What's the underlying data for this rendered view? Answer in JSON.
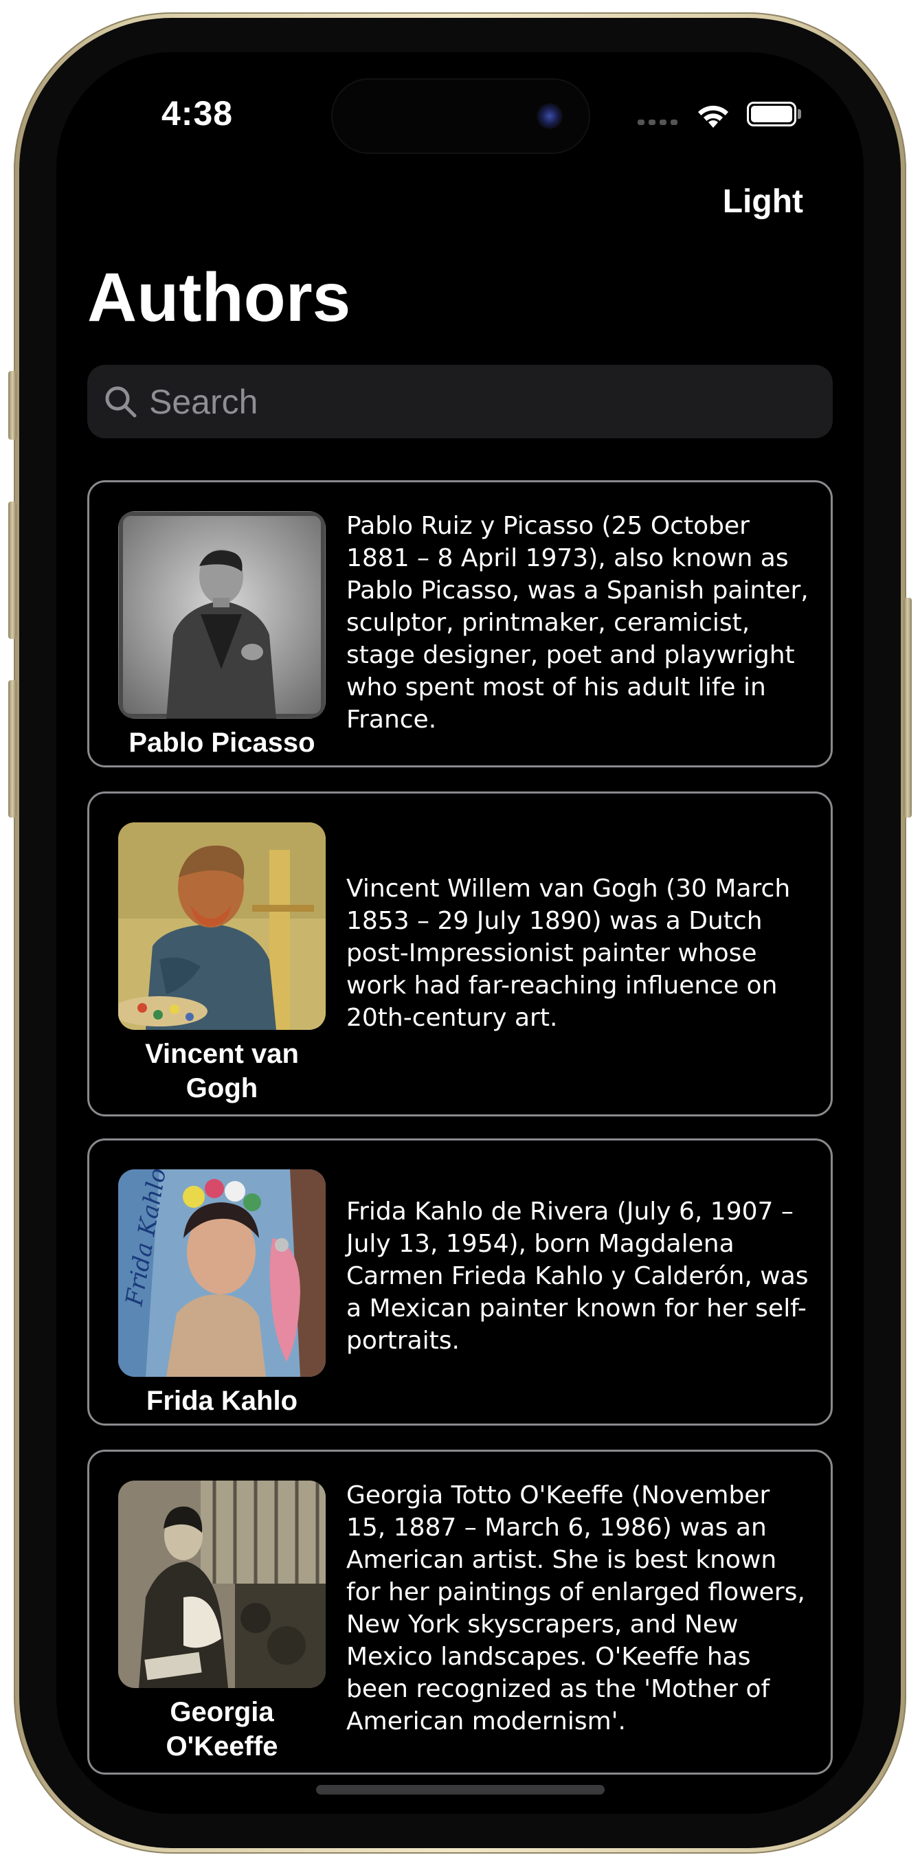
{
  "status_bar": {
    "time": "4:38",
    "icons": [
      "cellular-signal-icon",
      "wifi-icon",
      "battery-icon"
    ]
  },
  "nav": {
    "trailing_button": "Light"
  },
  "title": "Authors",
  "search": {
    "placeholder": "Search",
    "value": ""
  },
  "authors": [
    {
      "name": "Pablo Picasso",
      "description": "Pablo Ruiz y Picasso (25 October 1881 – 8 April 1973), also known as Pablo Picasso, was a Spanish painter, sculptor, printmaker, ceramicist, stage designer, poet and playwright who spent most of his adult life in France.",
      "portrait": "picasso-portrait"
    },
    {
      "name": "Vincent van Gogh",
      "description": "Vincent Willem van Gogh (30 March 1853 – 29 July 1890) was a Dutch post-Impressionist painter whose work had far-reaching influence on 20th-century art.",
      "portrait": "van-gogh-self-portrait"
    },
    {
      "name": "Frida Kahlo",
      "description": "Frida Kahlo de Rivera (July 6, 1907 – July 13, 1954), born Magdalena Carmen Frieda Kahlo y Calderón, was a Mexican painter known for her self-portraits.",
      "portrait": "frida-kahlo-painting",
      "portrait_text": "Frida Kahlo"
    },
    {
      "name": "Georgia O'Keeffe",
      "description": "Georgia Totto O'Keeffe (November 15, 1887 – March 6, 1986) was an American artist. She is best known for her paintings of enlarged flowers, New York skyscrapers, and New Mexico landscapes. O'Keeffe has been recognized as the 'Mother of American modernism'.",
      "portrait": "georgia-okeeffe-photo"
    }
  ],
  "colors": {
    "background": "#000000",
    "card_border": "#8a8a8e",
    "search_field": "#1c1c1e",
    "placeholder": "#8e8e93",
    "text": "#ffffff"
  }
}
